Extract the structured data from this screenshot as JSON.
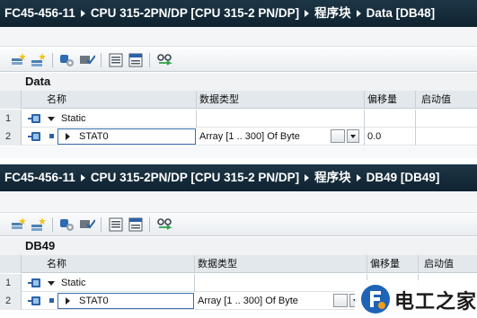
{
  "panels": [
    {
      "breadcrumb": [
        "FC45-456-11",
        "CPU 315-2PN/DP [CPU 315-2 PN/DP]",
        "程序块",
        "Data [DB48]"
      ],
      "block_name": "Data",
      "columns": [
        "名称",
        "数据类型",
        "偏移量",
        "启动值"
      ],
      "rows": [
        {
          "num": "1",
          "name": "Static",
          "type": "",
          "offset": ""
        },
        {
          "num": "2",
          "name": "STAT0",
          "type": "Array [1 .. 300] Of Byte",
          "offset": "0.0"
        }
      ]
    },
    {
      "breadcrumb": [
        "FC45-456-11",
        "CPU 315-2PN/DP [CPU 315-2 PN/DP]",
        "程序块",
        "DB49 [DB49]"
      ],
      "block_name": "DB49",
      "columns": [
        "名称",
        "数据类型",
        "偏移量",
        "启动值"
      ],
      "rows": [
        {
          "num": "1",
          "name": "Static",
          "type": "",
          "offset": ""
        },
        {
          "num": "2",
          "name": "STAT0",
          "type": "Array [1 .. 300] Of Byte",
          "offset": ""
        }
      ]
    }
  ],
  "watermark": {
    "text": "电工之家"
  },
  "colors": {
    "titlebar": "#142a38",
    "accent_blue": "#2a62a8",
    "header_bg": "#e3e8ec"
  },
  "icons": [
    "insert-row-icon",
    "add-row-icon",
    "online-monitor-icon",
    "snapshot-icon",
    "expand-all-icon",
    "collapse-all-icon",
    "compare-icon",
    "interface-icon",
    "dropdown-arrow-icon"
  ]
}
